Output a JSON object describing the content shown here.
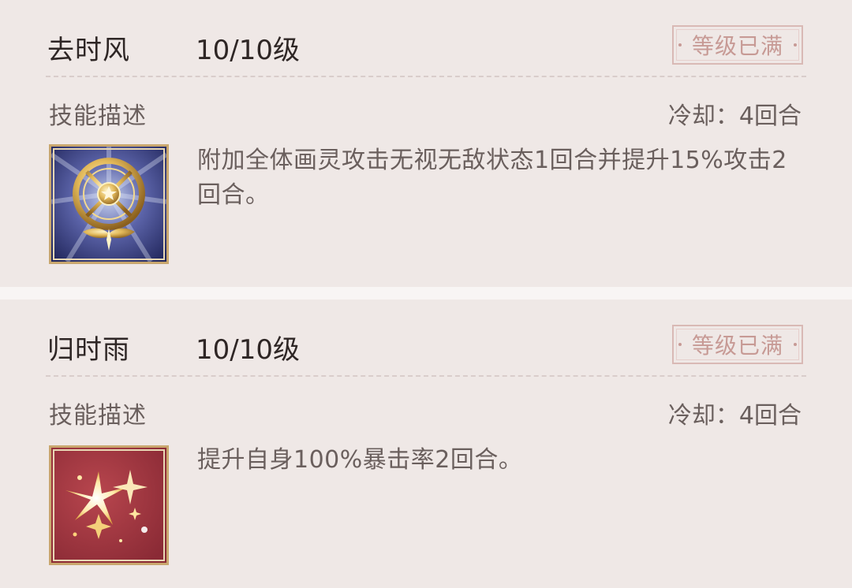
{
  "skills": [
    {
      "name": "去时风",
      "level": "10/10级",
      "badge": "等级已满",
      "desc_label": "技能描述",
      "cooldown": "冷却：4回合",
      "description": "附加全体画灵攻击无视无敌状态1回合并提升15%攻击2回合。",
      "icon": "golden-wheel-icon",
      "icon_bg": "#2a2f6e"
    },
    {
      "name": "归时雨",
      "level": "10/10级",
      "badge": "等级已满",
      "desc_label": "技能描述",
      "cooldown": "冷却：4回合",
      "description": "提升自身100%暴击率2回合。",
      "icon": "sparkle-burst-icon",
      "icon_bg": "#9b3440"
    }
  ],
  "colors": {
    "panel_bg": "#efe8e6",
    "badge": "#c79a95",
    "icon_frame": "#c9a76e"
  }
}
